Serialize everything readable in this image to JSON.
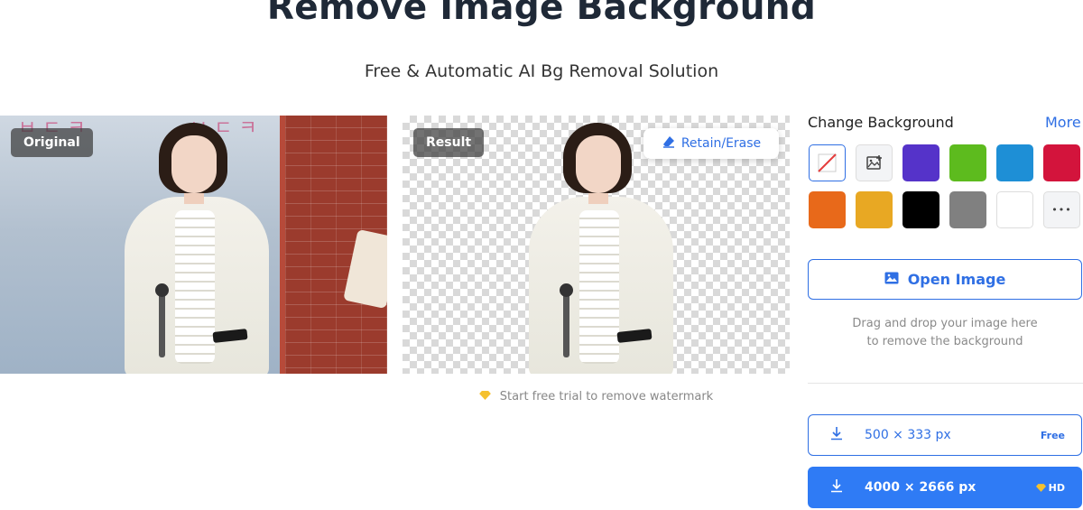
{
  "header": {
    "title": "Remove Image Background",
    "subtitle": "Free & Automatic AI Bg Removal Solution"
  },
  "preview": {
    "original_label": "Original",
    "result_label": "Result",
    "retain_erase_label": "Retain/Erase",
    "watermark_text": "Start free trial to remove watermark",
    "poster_text_top": "ㅂ ㄷ ㅋ",
    "poster_text_right": "ㅂ ㄷ ㅋ"
  },
  "sidebar": {
    "change_bg_label": "Change Background",
    "more_label": "More",
    "swatches": [
      {
        "name": "none",
        "color": "#ffffff"
      },
      {
        "name": "upload",
        "color": "#f3f4f6"
      },
      {
        "name": "purple",
        "color": "#5533c9"
      },
      {
        "name": "green",
        "color": "#5dbb1e"
      },
      {
        "name": "blue",
        "color": "#1e8fd6"
      },
      {
        "name": "red",
        "color": "#d3143c"
      },
      {
        "name": "orange",
        "color": "#e8691a"
      },
      {
        "name": "yellow",
        "color": "#e8a823"
      },
      {
        "name": "black",
        "color": "#000000"
      },
      {
        "name": "gray",
        "color": "#808080"
      },
      {
        "name": "white",
        "color": "#ffffff"
      },
      {
        "name": "more",
        "color": "#f3f4f6"
      }
    ],
    "more_swatch_glyph": "•••",
    "open_image_label": "Open Image",
    "drop_hint_line1": "Drag and drop your image here",
    "drop_hint_line2": "to remove the background",
    "download_free_size": "500 × 333 px",
    "download_free_tag": "Free",
    "download_hd_size": "4000 × 2666 px",
    "download_hd_tag": "HD"
  },
  "colors": {
    "accent": "#2f6fe4",
    "hd_button": "#2f7bf5",
    "diamond": "#f5c12e"
  }
}
